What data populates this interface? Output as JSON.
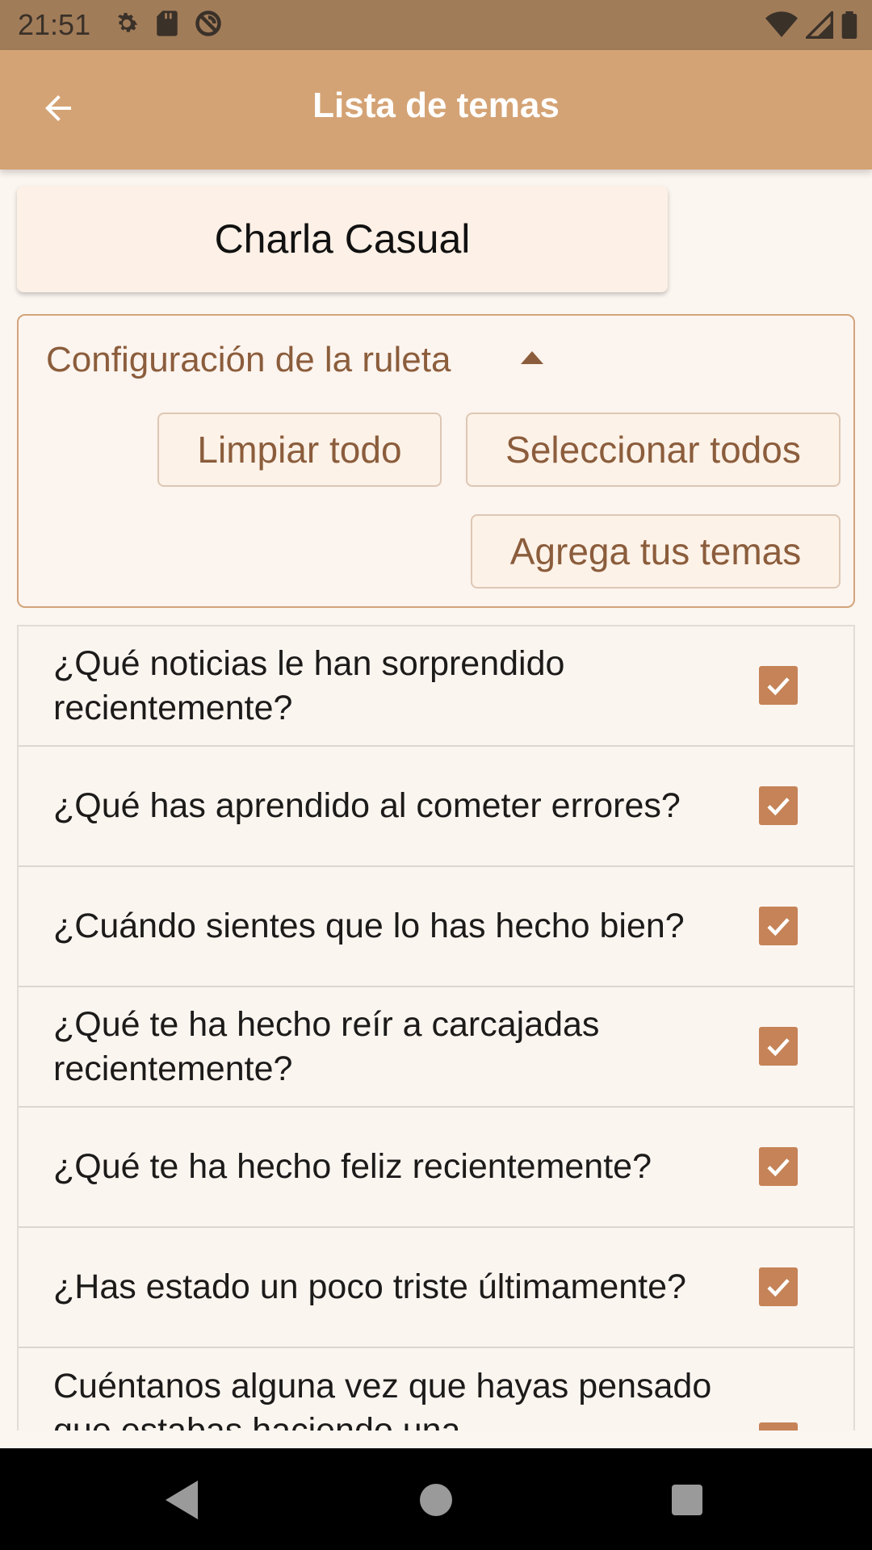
{
  "status_bar": {
    "time": "21:51",
    "left_icons": [
      "settings-icon",
      "sd-card-icon",
      "no-sync-icon"
    ],
    "right_icons": [
      "wifi-icon",
      "signal-icon",
      "battery-icon"
    ]
  },
  "app_bar": {
    "title": "Lista de temas",
    "back_icon": "arrow-left-icon"
  },
  "deck": {
    "title": "Charla Casual"
  },
  "config": {
    "label": "Configuración de la ruleta",
    "expanded": true,
    "clear_label": "Limpiar todo",
    "select_all_label": "Seleccionar todos",
    "add_label": "Agrega tus temas"
  },
  "topics": [
    {
      "text": "¿Qué noticias le han sorprendido recientemente?",
      "checked": true
    },
    {
      "text": "¿Qué has aprendido al cometer errores?",
      "checked": true
    },
    {
      "text": "¿Cuándo sientes que lo has hecho bien?",
      "checked": true
    },
    {
      "text": "¿Qué te ha hecho reír a carcajadas recientemente?",
      "checked": true
    },
    {
      "text": "¿Qué te ha hecho feliz recientemente?",
      "checked": true
    },
    {
      "text": "¿Has estado un poco triste últimamente?",
      "checked": true
    },
    {
      "text": "Cuéntanos alguna vez que hayas pensado que estabas haciendo una",
      "checked": true
    }
  ],
  "colors": {
    "app_bar": "#d4a375",
    "status_bar": "#a17c59",
    "accent": "#c58357",
    "button_text": "#8b5d3c",
    "background": "#fcf6f1"
  },
  "nav_bar": {
    "icons": [
      "nav-back-icon",
      "nav-home-icon",
      "nav-recents-icon"
    ]
  }
}
